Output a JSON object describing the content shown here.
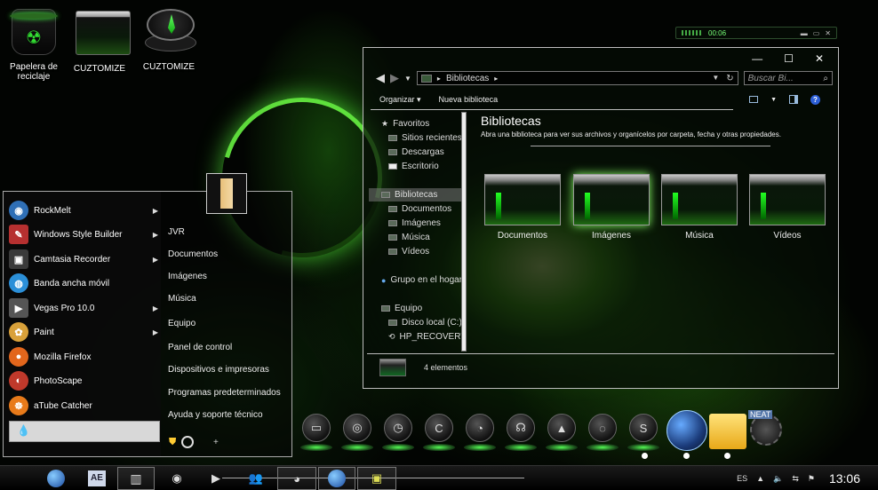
{
  "desktop": {
    "icons": [
      {
        "label": "Papelera de reciclaje"
      },
      {
        "label": "CUZTOMIZE"
      },
      {
        "label": "CUZTOMIZE"
      }
    ]
  },
  "player": {
    "time": "00:06"
  },
  "explorer": {
    "address": "Bibliotecas",
    "search_placeholder": "Buscar Bi...",
    "toolbar": {
      "organize": "Organizar",
      "new_library": "Nueva biblioteca"
    },
    "nav": {
      "favorites": "Favoritos",
      "recent_sites": "Sitios recientes",
      "downloads": "Descargas",
      "desktop": "Escritorio",
      "libraries": "Bibliotecas",
      "documents": "Documentos",
      "images": "Imágenes",
      "music": "Música",
      "videos": "Vídeos",
      "homegroup": "Grupo en el hogar",
      "computer": "Equipo",
      "local_disk": "Disco local (C:)",
      "recovery": "HP_RECOVERY"
    },
    "content": {
      "title": "Bibliotecas",
      "description": "Abra una biblioteca para ver sus archivos y organícelos por carpeta, fecha y otras propiedades.",
      "libraries": [
        "Documentos",
        "Imágenes",
        "Música",
        "Vídeos"
      ]
    },
    "status": "4 elementos"
  },
  "start_menu": {
    "programs": [
      {
        "label": "RockMelt",
        "arrow": "▶",
        "icon": "rockmelt-icon",
        "color": "#2f6fb6"
      },
      {
        "label": "Windows Style Builder",
        "arrow": "▶",
        "icon": "style-builder-icon",
        "color": "#b63030"
      },
      {
        "label": "Camtasia Recorder",
        "arrow": "▶",
        "icon": "camtasia-icon",
        "color": "#3a3a3a"
      },
      {
        "label": "Banda ancha móvil",
        "arrow": "",
        "icon": "mobile-broadband-icon",
        "color": "#2b8fd8"
      },
      {
        "label": "Vegas Pro 10.0",
        "arrow": "▶",
        "icon": "vegas-icon",
        "color": "#555555"
      },
      {
        "label": "Paint",
        "arrow": "▶",
        "icon": "paint-icon",
        "color": "#d9a13a"
      },
      {
        "label": "Mozilla Firefox",
        "arrow": "",
        "icon": "firefox-icon",
        "color": "#e2661c"
      },
      {
        "label": "PhotoScape",
        "arrow": "",
        "icon": "photoscape-icon",
        "color": "#c0392b"
      },
      {
        "label": "aTube Catcher",
        "arrow": "",
        "icon": "atube-icon",
        "color": "#e87a1a"
      }
    ],
    "places": [
      "JVR",
      "Documentos",
      "Imágenes",
      "Música",
      "Equipo",
      "Panel de control",
      "Dispositivos e impresoras",
      "Programas predeterminados",
      "Ayuda y soporte técnico"
    ],
    "plus": "+"
  },
  "dock": {
    "big_label": "NEAT"
  },
  "taskbar": {
    "lang": "ES",
    "time": "13:06"
  }
}
